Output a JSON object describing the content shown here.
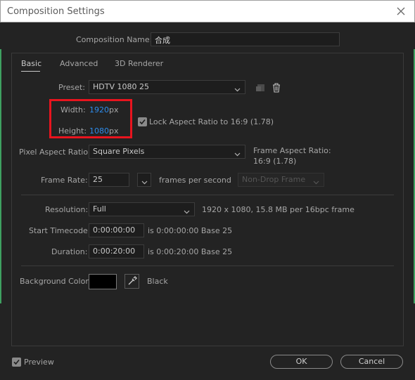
{
  "window": {
    "title": "Composition Settings"
  },
  "comp_name": {
    "label": "Composition Name:",
    "value": "合成"
  },
  "tabs": [
    {
      "label": "Basic",
      "active": true
    },
    {
      "label": "Advanced"
    },
    {
      "label": "3D Renderer"
    }
  ],
  "preset": {
    "label": "Preset:",
    "value": "HDTV 1080 25"
  },
  "width": {
    "label": "Width:",
    "value": "1920",
    "unit": "px"
  },
  "height": {
    "label": "Height:",
    "value": "1080",
    "unit": "px"
  },
  "lock_aspect": {
    "label": "Lock Aspect Ratio to 16:9 (1.78)",
    "checked": true
  },
  "pixel_aspect": {
    "label": "Pixel Aspect Ratio:",
    "value": "Square Pixels",
    "frame_aspect_label": "Frame Aspect Ratio:",
    "frame_aspect_value": "16:9 (1.78)"
  },
  "frame_rate": {
    "label": "Frame Rate:",
    "value": "25",
    "unit": "frames per second",
    "drop_frame": "Non-Drop Frame"
  },
  "resolution": {
    "label": "Resolution:",
    "value": "Full",
    "info": "1920 x 1080, 15.8 MB per 16bpc frame"
  },
  "start_timecode": {
    "label": "Start Timecode:",
    "value": "0:00:00:00",
    "info": "is 0:00:00:00  Base 25"
  },
  "duration": {
    "label": "Duration:",
    "value": "0:00:20:00",
    "info": "is 0:00:20:00  Base 25"
  },
  "background": {
    "label": "Background Color:",
    "color": "#000000",
    "name": "Black"
  },
  "footer": {
    "preview_label": "Preview",
    "preview_checked": true,
    "ok_label": "OK",
    "cancel_label": "Cancel"
  },
  "colors": {
    "accent_blue": "#2d8ceb",
    "highlight_red": "#e8141e",
    "edge_green": "#3fa061"
  }
}
